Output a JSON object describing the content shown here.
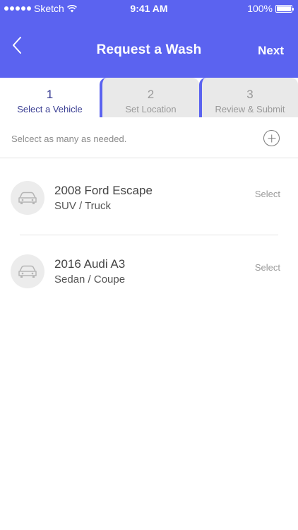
{
  "status_bar": {
    "carrier": "Sketch",
    "time": "9:41 AM",
    "battery": "100%"
  },
  "header": {
    "title": "Request a Wash",
    "next_label": "Next",
    "back_icon": "chevron-left-icon"
  },
  "tabs": [
    {
      "number": "1",
      "label": "Select a Vehicle",
      "active": true
    },
    {
      "number": "2",
      "label": "Set Location",
      "active": false
    },
    {
      "number": "3",
      "label": "Review & Submit",
      "active": false
    }
  ],
  "hint": {
    "text": "Selcect as many as needed.",
    "add_icon": "plus-circle-icon"
  },
  "vehicles": [
    {
      "name": "2008 Ford Escape",
      "type": "SUV / Truck",
      "action": "Select",
      "icon": "car-icon"
    },
    {
      "name": "2016 Audi A3",
      "type": "Sedan / Coupe",
      "action": "Select",
      "icon": "car-icon"
    }
  ],
  "colors": {
    "primary": "#5b63f0",
    "active_tab_text": "#3b3f93",
    "inactive_tab_bg": "#e9e9e9"
  }
}
